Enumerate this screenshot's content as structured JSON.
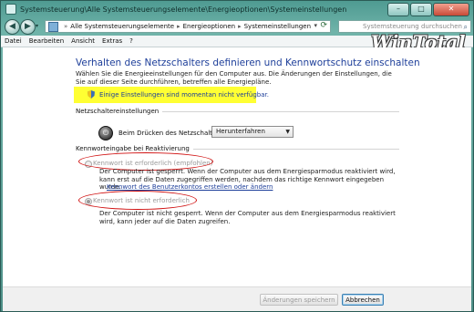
{
  "window": {
    "title": "Systemsteuerung\\Alle Systemsteuerungselemente\\Energieoptionen\\Systemeinstellungen"
  },
  "address": {
    "crumbs": [
      "Alle Systemsteuerungselemente",
      "Energieoptionen",
      "Systemeinstellungen"
    ]
  },
  "search": {
    "placeholder": "Systemsteuerung durchsuchen"
  },
  "menu": {
    "items": [
      "Datei",
      "Bearbeiten",
      "Ansicht",
      "Extras",
      "?"
    ]
  },
  "logo": {
    "text": "WinTotal"
  },
  "page": {
    "heading": "Verhalten des Netzschalters definieren und Kennwortschutz einschalten",
    "intro": "Wählen Sie die Energieeinstellungen für den Computer aus. Die Änderungen der Einstellungen, die Sie auf dieser Seite durchführen, betreffen alle Energiepläne.",
    "unavailable_link": "Einige Einstellungen sind momentan nicht verfügbar."
  },
  "power": {
    "section_title": "Netzschaltereinstellungen",
    "label": "Beim Drücken des Netzschalters:",
    "selected": "Herunterfahren"
  },
  "password": {
    "section_title": "Kennworteingabe bei Reaktivierung",
    "option1": {
      "label": "Kennwort ist erforderlich (empfohlen)",
      "description": "Der Computer ist gesperrt. Wenn der Computer aus dem Energiesparmodus reaktiviert wird, kann erst auf die Daten zugegriffen werden, nachdem das richtige Kennwort eingegeben wurde.",
      "link": "Kennwort des Benutzerkontos erstellen oder ändern"
    },
    "option2": {
      "label": "Kennwort ist nicht erforderlich",
      "description": "Der Computer ist nicht gesperrt. Wenn der Computer aus dem Energiesparmodus reaktiviert wird, kann jeder auf die Daten zugreifen.",
      "selected": true
    }
  },
  "buttons": {
    "save": "Änderungen speichern",
    "cancel": "Abbrechen"
  },
  "colors": {
    "highlight": "#ffff33",
    "annotation": "#d01010",
    "link": "#1e3f9a"
  }
}
